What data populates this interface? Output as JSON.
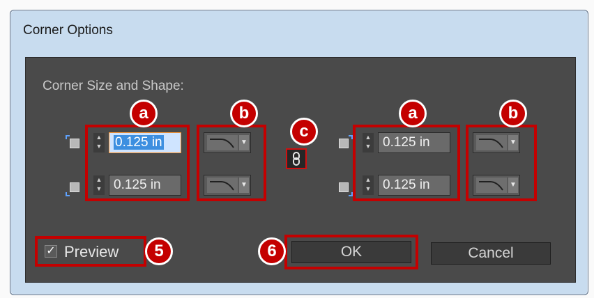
{
  "window": {
    "title": "Corner Options"
  },
  "dialog": {
    "section_label": "Corner Size and Shape:"
  },
  "corners": {
    "top_left": {
      "size": "0.125 in"
    },
    "bottom_left": {
      "size": "0.125 in"
    },
    "top_right": {
      "size": "0.125 in"
    },
    "bottom_right": {
      "size": "0.125 in"
    }
  },
  "icons": {
    "stepper": "up-down-arrows-icon",
    "shape": "rounded-corner-shape-icon",
    "link": "chain-link-icon",
    "checkmark": "check-icon"
  },
  "callouts": {
    "a": "a",
    "b": "b",
    "c": "c",
    "five": "5",
    "six": "6"
  },
  "preview": {
    "label": "Preview",
    "checked": true
  },
  "buttons": {
    "ok": "OK",
    "cancel": "Cancel"
  },
  "colors": {
    "dialog_bg": "#4a4a4a",
    "callout_red": "#c40000",
    "focus_orange": "#ff9933",
    "selection_blue": "#3d8fe0"
  }
}
